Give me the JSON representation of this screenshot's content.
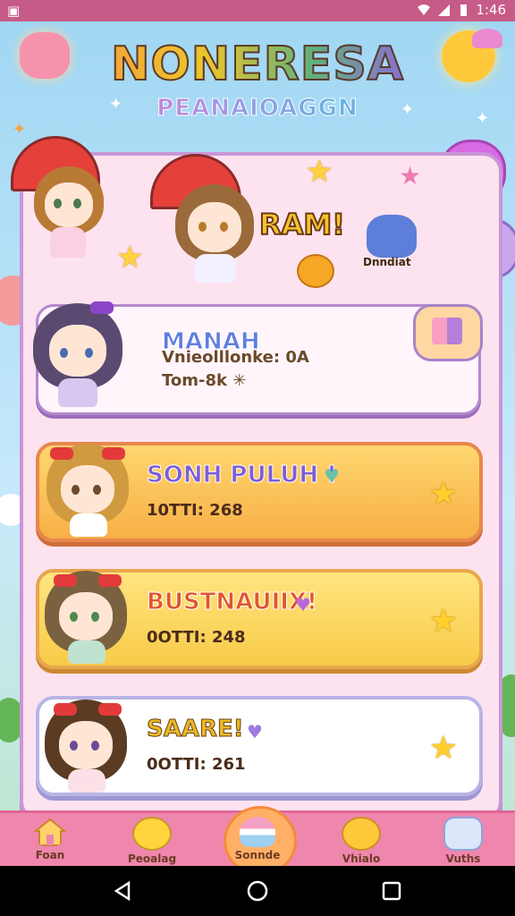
{
  "status_bar": {
    "time": "1:46",
    "left_icon": "notification-icon"
  },
  "header": {
    "title": "NONERESA",
    "subtitle": "PEANAIOAGGN"
  },
  "banner": {
    "shout": "RAM!",
    "mascot_label": "Dnndiat"
  },
  "entries": [
    {
      "name": "MANAH",
      "line1": "Vnieolllonke: 0A",
      "line2": "Tom-8k ✳",
      "style": "first"
    },
    {
      "name": "SONH PULUH ! ",
      "line1": "10TTI: 268",
      "style": "orange"
    },
    {
      "name": "BUSTNAUIIX!",
      "line1": "0OTTI: 248",
      "style": "yellow"
    },
    {
      "name": "SAARE!",
      "line1": "0OTTI: 261",
      "style": "white"
    }
  ],
  "nav": [
    {
      "label": "Foan",
      "icon": "house-icon"
    },
    {
      "label": "Peoalag",
      "icon": "smiley-icon"
    },
    {
      "label": "Sonnde",
      "icon": "cake-icon",
      "active": true
    },
    {
      "label": "Vhialo",
      "icon": "chick-icon"
    },
    {
      "label": "Vuths",
      "icon": "bubble-icon"
    }
  ],
  "colors": {
    "accent": "#ef86ad",
    "panel_border": "#c996d8",
    "star": "#ffcf2e"
  }
}
